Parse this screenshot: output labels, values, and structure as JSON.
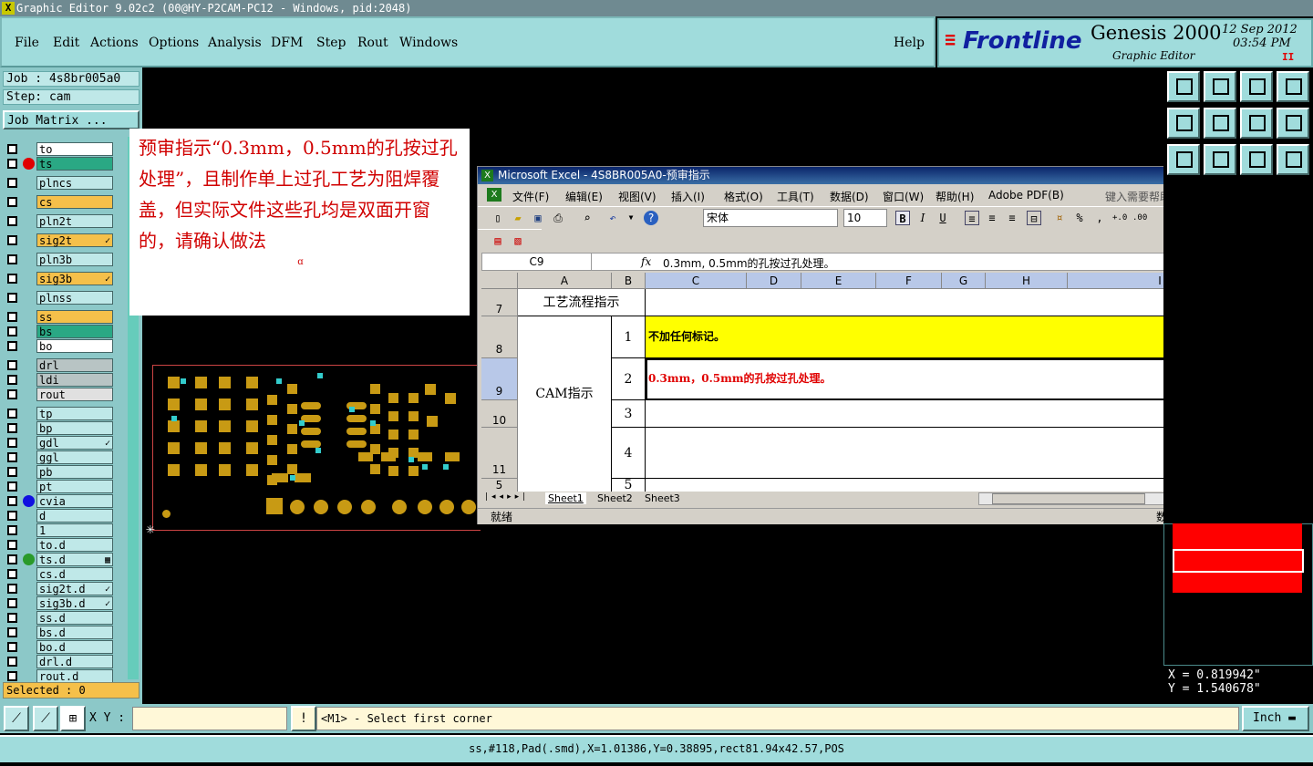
{
  "window": {
    "title": "Graphic Editor 9.02c2 (00@HY-P2CAM-PC12 - Windows, pid:2048)"
  },
  "menu": {
    "items": [
      "File",
      "Edit",
      "Actions",
      "Options",
      "Analysis",
      "DFM",
      "Step",
      "Rout",
      "Windows"
    ],
    "help": "Help"
  },
  "brand": {
    "logo": "Frontline",
    "product": "Genesis 2000",
    "subtitle": "Graphic Editor",
    "date": "12 Sep 2012",
    "time": "03:54 PM",
    "marker": "II"
  },
  "job": {
    "job_label": "Job : 4s8br005a0",
    "step_label": "Step: cam",
    "matrix_button": "Job Matrix ..."
  },
  "layers": [
    {
      "name": "to",
      "color": "#ffffff",
      "dot": ""
    },
    {
      "name": "ts",
      "color": "#2aa884",
      "dot": "#e00000"
    },
    {
      "name": "plncs",
      "color": "#bfe8e8",
      "dot": ""
    },
    {
      "name": "cs",
      "color": "#f5c04a",
      "dot": ""
    },
    {
      "name": "pln2t",
      "color": "#bfe8e8",
      "dot": ""
    },
    {
      "name": "sig2t",
      "color": "#f5c04a",
      "dot": "",
      "mark": "✓"
    },
    {
      "name": "pln3b",
      "color": "#bfe8e8",
      "dot": ""
    },
    {
      "name": "sig3b",
      "color": "#f5c04a",
      "dot": "",
      "mark": "✓"
    },
    {
      "name": "plnss",
      "color": "#bfe8e8",
      "dot": ""
    },
    {
      "name": "ss",
      "color": "#f5c04a",
      "dot": ""
    },
    {
      "name": "bs",
      "color": "#2aa884",
      "dot": ""
    },
    {
      "name": "bo",
      "color": "#ffffff",
      "dot": ""
    },
    {
      "name": "drl",
      "color": "#b8c4c4",
      "dot": ""
    },
    {
      "name": "ldi",
      "color": "#b8c4c4",
      "dot": ""
    },
    {
      "name": "rout",
      "color": "#e0e0e0",
      "dot": ""
    },
    {
      "name": "tp",
      "color": "#bfe8e8",
      "dot": ""
    },
    {
      "name": "bp",
      "color": "#bfe8e8",
      "dot": ""
    },
    {
      "name": "gdl",
      "color": "#bfe8e8",
      "dot": "",
      "mark": "✓"
    },
    {
      "name": "ggl",
      "color": "#bfe8e8",
      "dot": ""
    },
    {
      "name": "pb",
      "color": "#bfe8e8",
      "dot": ""
    },
    {
      "name": "pt",
      "color": "#bfe8e8",
      "dot": ""
    },
    {
      "name": "cvia",
      "color": "#bfe8e8",
      "dot": "#1010e0"
    },
    {
      "name": "d",
      "color": "#bfe8e8",
      "dot": ""
    },
    {
      "name": "1",
      "color": "#bfe8e8",
      "dot": ""
    },
    {
      "name": "to.d",
      "color": "#bfe8e8",
      "dot": ""
    },
    {
      "name": "ts.d",
      "color": "#bfe8e8",
      "dot": "#2a9a2a",
      "mark": "▦"
    },
    {
      "name": "cs.d",
      "color": "#bfe8e8",
      "dot": ""
    },
    {
      "name": "sig2t.d",
      "color": "#bfe8e8",
      "dot": "",
      "mark": "✓"
    },
    {
      "name": "sig3b.d",
      "color": "#bfe8e8",
      "dot": "",
      "mark": "✓"
    },
    {
      "name": "ss.d",
      "color": "#bfe8e8",
      "dot": ""
    },
    {
      "name": "bs.d",
      "color": "#bfe8e8",
      "dot": ""
    },
    {
      "name": "bo.d",
      "color": "#bfe8e8",
      "dot": ""
    },
    {
      "name": "drl.d",
      "color": "#bfe8e8",
      "dot": ""
    },
    {
      "name": "rout.d",
      "color": "#bfe8e8",
      "dot": ""
    }
  ],
  "selected": "Selected : 0",
  "note": {
    "text": "预审指示“0.3mm，0.5mm的孔按过孔处理”，且制作单上过孔工艺为阻焊覆盖，但实际文件这些孔均是双面开窗的，请确认做法",
    "mark": "ɑ"
  },
  "excel": {
    "title": "Microsoft Excel - 4S8BR005A0-预审指示",
    "menu": [
      "文件(F)",
      "编辑(E)",
      "视图(V)",
      "插入(I)",
      "格式(O)",
      "工具(T)",
      "数据(D)",
      "窗口(W)",
      "帮助(H)",
      "Adobe PDF(B)"
    ],
    "help_placeholder": "键入需要帮助的问题",
    "font_name": "宋体",
    "font_size": "10",
    "name_box": "C9",
    "fx": "fx",
    "formula": "0.3mm, 0.5mm的孔按过孔处理。",
    "columns": [
      "A",
      "B",
      "C",
      "D",
      "E",
      "F",
      "G",
      "H",
      "I"
    ],
    "rows": [
      "7",
      "8",
      "9",
      "10",
      "11",
      "5"
    ],
    "cells": {
      "a7": "工艺流程指示",
      "a_cam": "CAM指示",
      "b8": "1",
      "b9": "2",
      "b10": "3",
      "b11": "4",
      "b12": "5",
      "c8": "不加任何标记。",
      "c9": "0.3mm，0.5mm的孔按过孔处理。"
    },
    "sheets": [
      "Sheet1",
      "Sheet2",
      "Sheet3"
    ],
    "status_left": "就绪",
    "status_right": "数字"
  },
  "coords": {
    "x": "X = 0.819942\"",
    "y": "Y = 1.540678\""
  },
  "bottom": {
    "xy_label": "X Y :",
    "prompt": "<M1> - Select first corner",
    "unit": "Inch"
  },
  "statusbar": {
    "text": "ss,#118,Pad(.smd),X=1.01386,Y=0.38895,rect81.94x42.57,POS"
  },
  "colors": {
    "accent": "#a0dcdc",
    "note_text": "#d00000",
    "yellow_cell": "#ffff00",
    "red_block": "#ff0000"
  }
}
